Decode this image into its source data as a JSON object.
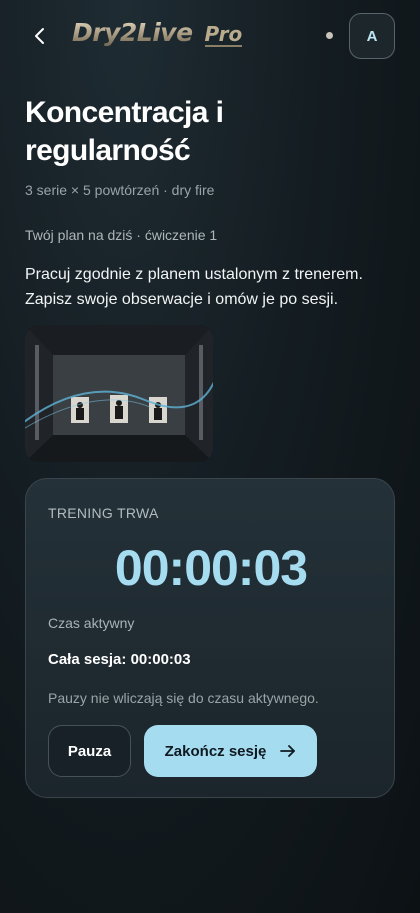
{
  "header": {
    "logo_main": "Dry2Live",
    "logo_pro": "Pro",
    "avatar_initial": "A"
  },
  "exercise": {
    "title": "Koncentracja i regularność",
    "subtitle": "3 serie × 5 powtórzeń · dry fire",
    "plan": "Twój plan na dziś · ćwiczenie 1",
    "description": "Pracuj zgodnie z planem ustalonym z trenerem. Zapisz swoje obserwacje i omów je po sesji."
  },
  "session": {
    "status_label": "TRENING TRWA",
    "timer": "00:00:03",
    "active_label": "Czas aktywny",
    "total_label": "Cała sesja:",
    "total_value": "00:00:03",
    "pause_note": "Pauzy nie wliczają się do czasu aktywnego.",
    "pause_button": "Pauza",
    "end_button": "Zakończ sesję"
  },
  "icons": {
    "back": "chevron-left-icon",
    "end_arrow": "arrow-right-icon"
  },
  "colors": {
    "accent": "#a6dcf0",
    "background": "#141d22",
    "card": "#1f2a30"
  }
}
